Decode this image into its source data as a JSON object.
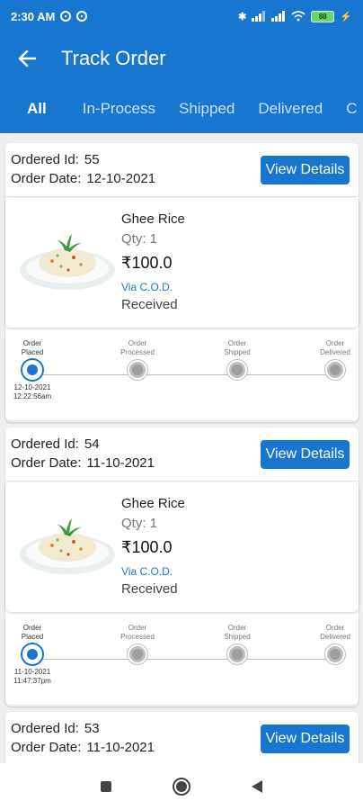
{
  "status_bar": {
    "time": "2:30 AM",
    "battery": "88"
  },
  "header": {
    "title": "Track Order"
  },
  "tabs": [
    "All",
    "In-Process",
    "Shipped",
    "Delivered",
    "C"
  ],
  "orders": [
    {
      "id_label": "Ordered Id:",
      "id": "55",
      "date_label": "Order Date:",
      "date": "12-10-2021",
      "button": "View Details",
      "item": {
        "name": "Ghee Rice",
        "qty": "Qty: 1",
        "price": "₹100.0",
        "payment": "Via C.O.D.",
        "status": "Received"
      },
      "steps": [
        {
          "label_1": "Order",
          "label_2": "Placed",
          "date": "12-10-2021",
          "time": "12:22:56am"
        },
        {
          "label_1": "Order",
          "label_2": "Processed"
        },
        {
          "label_1": "Order",
          "label_2": "Shipped"
        },
        {
          "label_1": "Order",
          "label_2": "Delivered"
        }
      ]
    },
    {
      "id_label": "Ordered Id:",
      "id": "54",
      "date_label": "Order Date:",
      "date": "11-10-2021",
      "button": "View Details",
      "item": {
        "name": "Ghee Rice",
        "qty": "Qty: 1",
        "price": "₹100.0",
        "payment": "Via C.O.D.",
        "status": "Received"
      },
      "steps": [
        {
          "label_1": "Order",
          "label_2": "Placed",
          "date": "11-10-2021",
          "time": "11:47:37pm"
        },
        {
          "label_1": "Order",
          "label_2": "Processed"
        },
        {
          "label_1": "Order",
          "label_2": "Shipped"
        },
        {
          "label_1": "Order",
          "label_2": "Delivered"
        }
      ]
    },
    {
      "id_label": "Ordered Id:",
      "id": "53",
      "date_label": "Order Date:",
      "date": "11-10-2021",
      "button": "View Details"
    }
  ]
}
